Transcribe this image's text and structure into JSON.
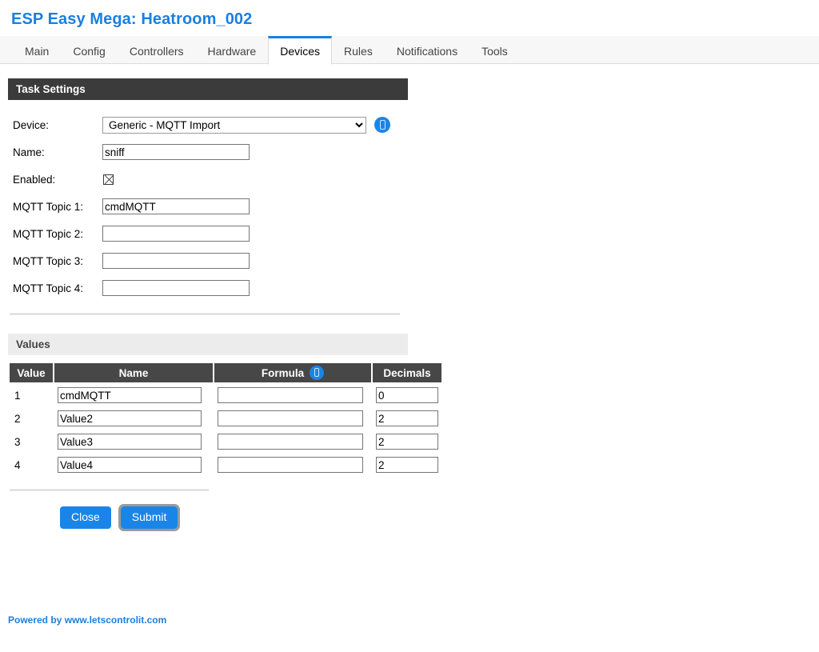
{
  "header": {
    "site_title": "ESP Easy Mega: Heatroom_002"
  },
  "tabs": [
    {
      "label": "Main",
      "active": false
    },
    {
      "label": "Config",
      "active": false
    },
    {
      "label": "Controllers",
      "active": false
    },
    {
      "label": "Hardware",
      "active": false
    },
    {
      "label": "Devices",
      "active": true
    },
    {
      "label": "Rules",
      "active": false
    },
    {
      "label": "Notifications",
      "active": false
    },
    {
      "label": "Tools",
      "active": false
    }
  ],
  "task_settings": {
    "section_title": "Task Settings",
    "device": {
      "label": "Device:",
      "selected": "Generic - MQTT Import",
      "options": [
        "Generic - MQTT Import"
      ],
      "info_icon": "info-document-icon"
    },
    "name": {
      "label": "Name:",
      "value": "sniff",
      "placeholder": ""
    },
    "enabled": {
      "label": "Enabled:",
      "checked": true
    },
    "topics": [
      {
        "label": "MQTT Topic 1:",
        "value": "cmdMQTT",
        "placeholder": ""
      },
      {
        "label": "MQTT Topic 2:",
        "value": "",
        "placeholder": ""
      },
      {
        "label": "MQTT Topic 3:",
        "value": "",
        "placeholder": ""
      },
      {
        "label": "MQTT Topic 4:",
        "value": "",
        "placeholder": ""
      }
    ]
  },
  "values": {
    "section_title": "Values",
    "columns": {
      "value": "Value",
      "name": "Name",
      "formula": "Formula",
      "decimals": "Decimals"
    },
    "formula_info_icon": "info-document-icon",
    "rows": [
      {
        "index": "1",
        "name": "cmdMQTT",
        "formula": "",
        "decimals": "0"
      },
      {
        "index": "2",
        "name": "Value2",
        "formula": "",
        "decimals": "2"
      },
      {
        "index": "3",
        "name": "Value3",
        "formula": "",
        "decimals": "2"
      },
      {
        "index": "4",
        "name": "Value4",
        "formula": "",
        "decimals": "2"
      }
    ]
  },
  "buttons": {
    "close": "Close",
    "submit": "Submit"
  },
  "footer": {
    "text": "Powered by www.letscontrolit.com"
  },
  "colors": {
    "accent_blue": "#1a85e8",
    "title_blue": "#1a7fe0",
    "dark_bar": "#3b3b3b",
    "table_header": "#474747",
    "light_bar": "#ececec",
    "tabbar_bg": "#f7f7f7"
  }
}
